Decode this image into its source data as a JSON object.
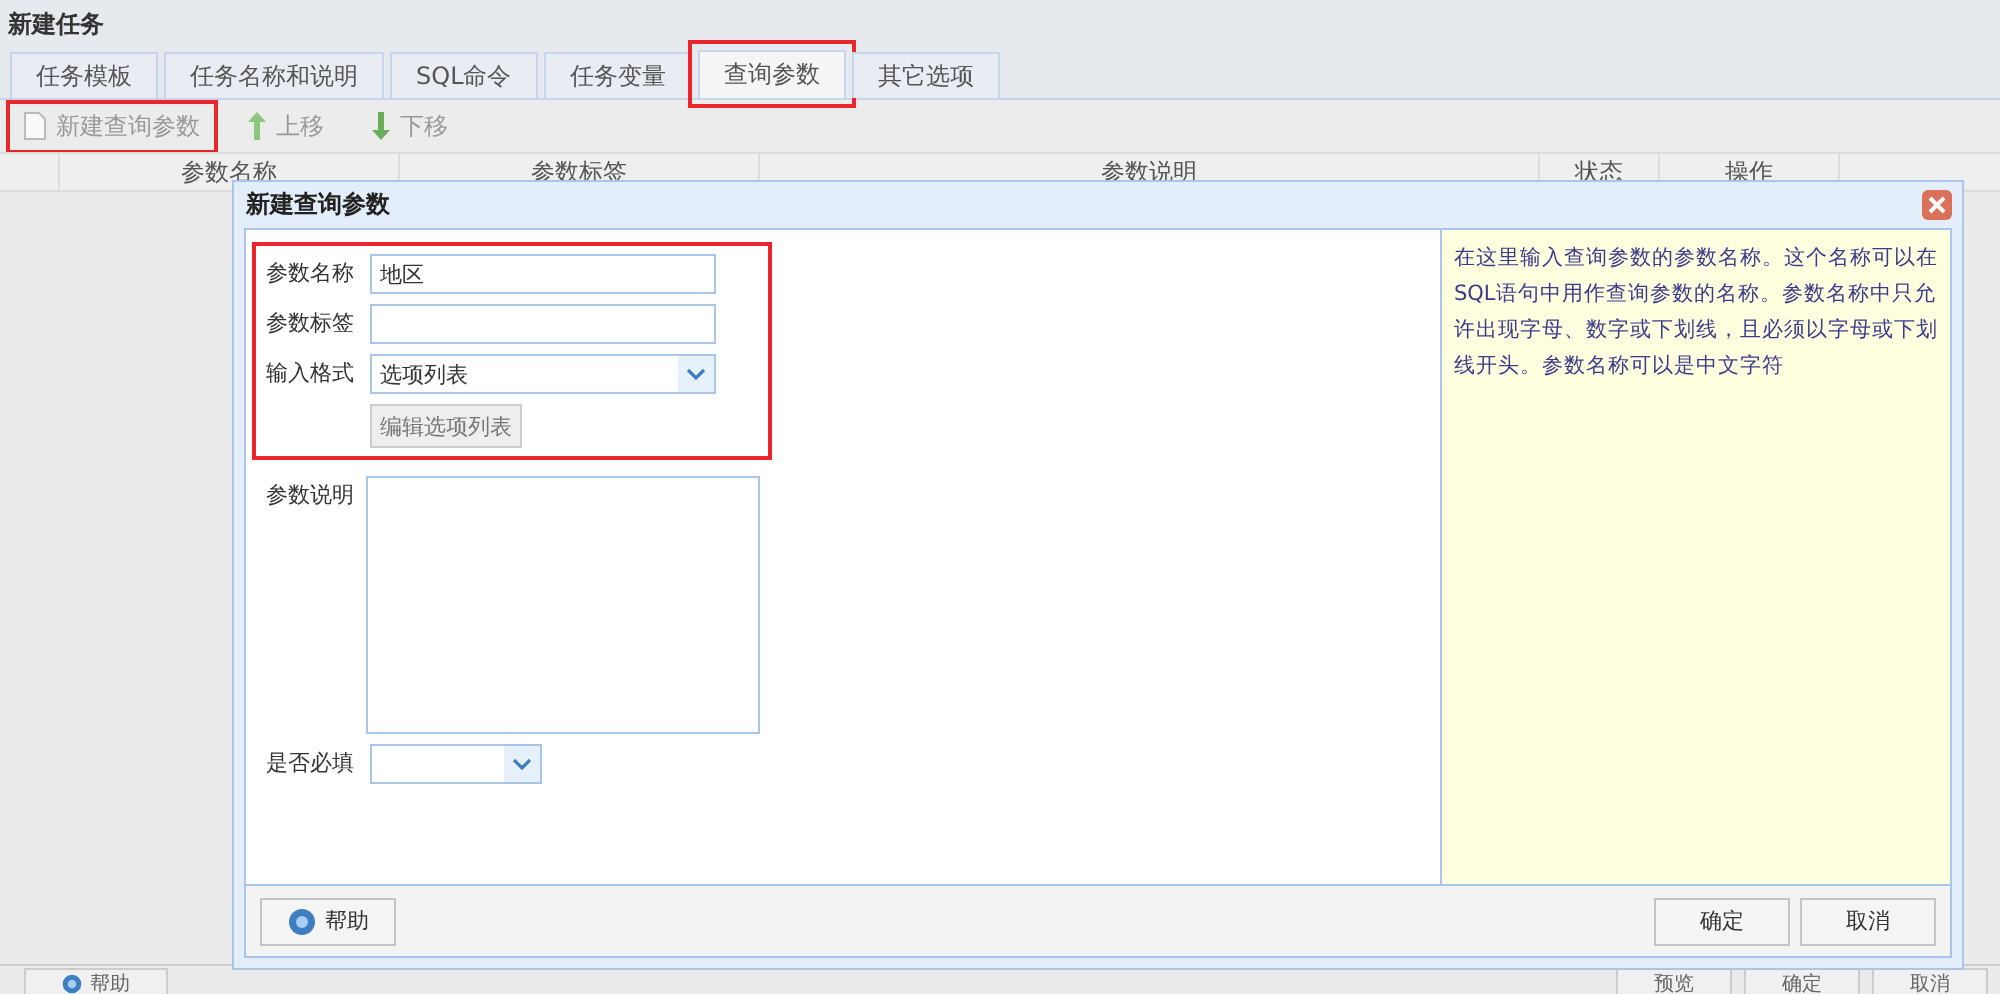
{
  "window": {
    "title": "新建任务"
  },
  "tabs": [
    {
      "label": "任务模板",
      "selected": false,
      "highlighted": false
    },
    {
      "label": "任务名称和说明",
      "selected": false,
      "highlighted": false
    },
    {
      "label": "SQL命令",
      "selected": false,
      "highlighted": false
    },
    {
      "label": "任务变量",
      "selected": false,
      "highlighted": false
    },
    {
      "label": "查询参数",
      "selected": true,
      "highlighted": true
    },
    {
      "label": "其它选项",
      "selected": false,
      "highlighted": false
    }
  ],
  "toolbar": [
    {
      "kind": "new",
      "label": "新建查询参数",
      "disabled": true,
      "highlighted": true
    },
    {
      "kind": "up",
      "label": "上移",
      "disabled": true,
      "highlighted": false
    },
    {
      "kind": "down",
      "label": "下移",
      "disabled": true,
      "highlighted": false
    }
  ],
  "table": {
    "columns": [
      "参数名称",
      "参数标签",
      "参数说明",
      "状态",
      "操作"
    ]
  },
  "dialog": {
    "title": "新建查询参数",
    "groups": [
      {
        "highlighted": true,
        "fields": [
          {
            "kind": "text",
            "label": "参数名称",
            "value": "地区"
          },
          {
            "kind": "text",
            "label": "参数标签"
          },
          {
            "kind": "select",
            "label": "输入格式",
            "value": "选项列表"
          },
          {
            "kind": "button",
            "label": "编辑选项列表"
          }
        ]
      },
      {
        "highlighted": false,
        "fields": [
          {
            "kind": "textarea",
            "label": "参数说明"
          },
          {
            "kind": "select",
            "label": "是否必填",
            "short": true
          }
        ]
      }
    ],
    "help_text": "在这里输入查询参数的参数名称。这个名称可以在SQL语句中用作查询参数的名称。参数名称中只允许出现字母、数字或下划线，且必须以字母或下划线开头。参数名称可以是中文字符",
    "buttons": [
      {
        "kind": "help",
        "label": "帮助"
      },
      {
        "kind": "ok",
        "label": "确定"
      },
      {
        "kind": "cancel",
        "label": "取消"
      }
    ]
  },
  "footer": {
    "buttons": [
      {
        "kind": "help",
        "label": "帮助"
      },
      {
        "kind": "plain",
        "label": "预览"
      },
      {
        "kind": "plain",
        "label": "确定"
      },
      {
        "kind": "plain",
        "label": "取消"
      }
    ]
  }
}
